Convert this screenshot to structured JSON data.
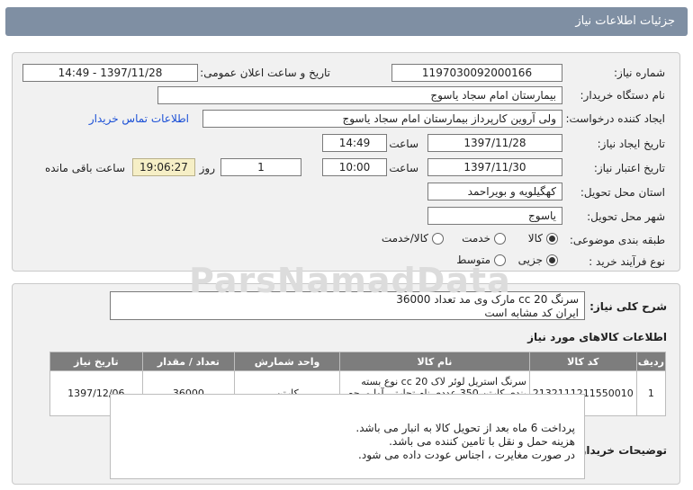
{
  "header": {
    "title": "جزئیات اطلاعات نیاز"
  },
  "form": {
    "need_number_label": "شماره نیاز:",
    "need_number": "1197030092000166",
    "announce_label": "تاریخ و ساعت اعلان عمومی:",
    "announce_value": "1397/11/28 - 14:49",
    "buyer_org_label": "نام دستگاه خریدار:",
    "buyer_org": "بیمارستان امام سجاد یاسوج",
    "requester_label": "ایجاد کننده درخواست:",
    "requester": "ولی آروین کارپرداز بیمارستان امام سجاد یاسوج",
    "contact_link": "اطلاعات تماس خریدار",
    "created_label": "تاریخ ایجاد نیاز:",
    "created_date": "1397/11/28",
    "time_label": "ساعت",
    "created_time": "14:49",
    "validity_label": "تاریخ اعتبار نیاز:",
    "validity_date": "1397/11/30",
    "validity_time": "10:00",
    "days_value": "1",
    "days_label": "روز و",
    "remaining_time": "19:06:27",
    "remaining_label": "ساعت باقی مانده",
    "province_label": "استان محل تحویل:",
    "province": "کهگیلویه و بویراحمد",
    "city_label": "شهر محل تحویل:",
    "city": "یاسوج",
    "category_label": "طبقه بندی موضوعی:",
    "category_options": [
      "کالا",
      "خدمت",
      "کالا/خدمت"
    ],
    "process_label": "نوع فرآیند خرید :",
    "process_options": [
      "جزیی",
      "متوسط"
    ]
  },
  "summary": {
    "label": "شرح کلی نیاز:",
    "line1": "سرنگ  cc 20  مارک وی مد تعداد 36000",
    "line2": "ایران کد مشابه است"
  },
  "items_section": {
    "title": "اطلاعات کالاهای مورد نیاز",
    "columns": [
      "ردیف",
      "کد کالا",
      "نام کالا",
      "واحد شمارش",
      "تعداد / مقدار",
      "تاریخ نیاز"
    ],
    "rows": [
      {
        "row": "1",
        "code": "2132111211550010",
        "name": "سرنگ استریل لوئر لاک cc 20 نوع بسته بندی کارتن 350 عددی نام تجارتی آوا مرجع عرضه کننده تولیدی و صنعتی آوا پزشک",
        "unit": "کارتن",
        "qty": "36000",
        "date": "1397/12/06"
      }
    ]
  },
  "notes": {
    "label": "توضیحات خریدار:",
    "lines": [
      "پرداخت 6 ماه بعد از تحویل کالا به انبار می باشد.",
      "هزینه حمل و نقل با تامین کننده می باشد.",
      "در صورت مغایرت ، اجناس عودت داده می شود."
    ]
  },
  "watermark": "ParsNamadData"
}
